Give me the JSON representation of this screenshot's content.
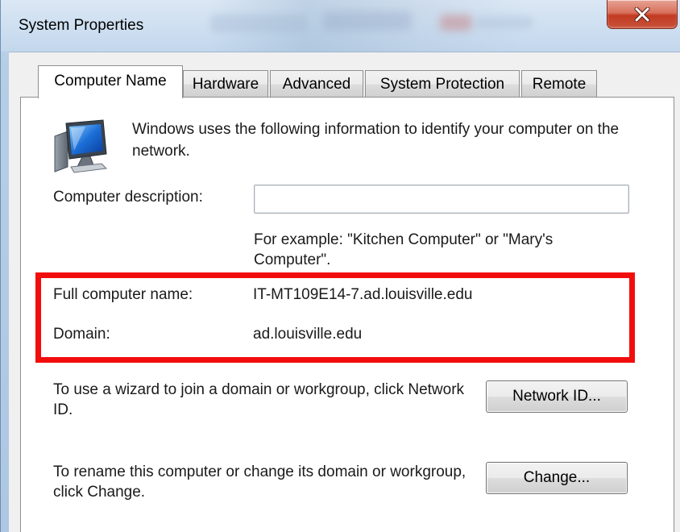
{
  "window": {
    "title": "System Properties",
    "close_icon": "close-x-icon"
  },
  "tabs": [
    {
      "label": "Computer Name",
      "selected": true
    },
    {
      "label": "Hardware",
      "selected": false
    },
    {
      "label": "Advanced",
      "selected": false
    },
    {
      "label": "System Protection",
      "selected": false
    },
    {
      "label": "Remote",
      "selected": false
    }
  ],
  "computer_name_page": {
    "icon": "computer-monitor-icon",
    "intro": "Windows uses the following information to identify your computer on the network.",
    "description_label": "Computer description:",
    "description_value": "",
    "description_placeholder": "",
    "example": "For example: \"Kitchen Computer\" or \"Mary's Computer\".",
    "full_name_label": "Full computer name:",
    "full_name_value": "IT-MT109E14-7.ad.louisville.edu",
    "domain_label": "Domain:",
    "domain_value": "ad.louisville.edu",
    "wizard_text": "To use a wizard to join a domain or workgroup, click Network ID.",
    "network_id_button": "Network ID...",
    "rename_text": "To rename this computer or change its domain or workgroup, click Change.",
    "change_button": "Change..."
  },
  "colors": {
    "highlight": "#f20d0d",
    "close_button": "#c23b22",
    "title_bar": "#c9dcf0"
  }
}
